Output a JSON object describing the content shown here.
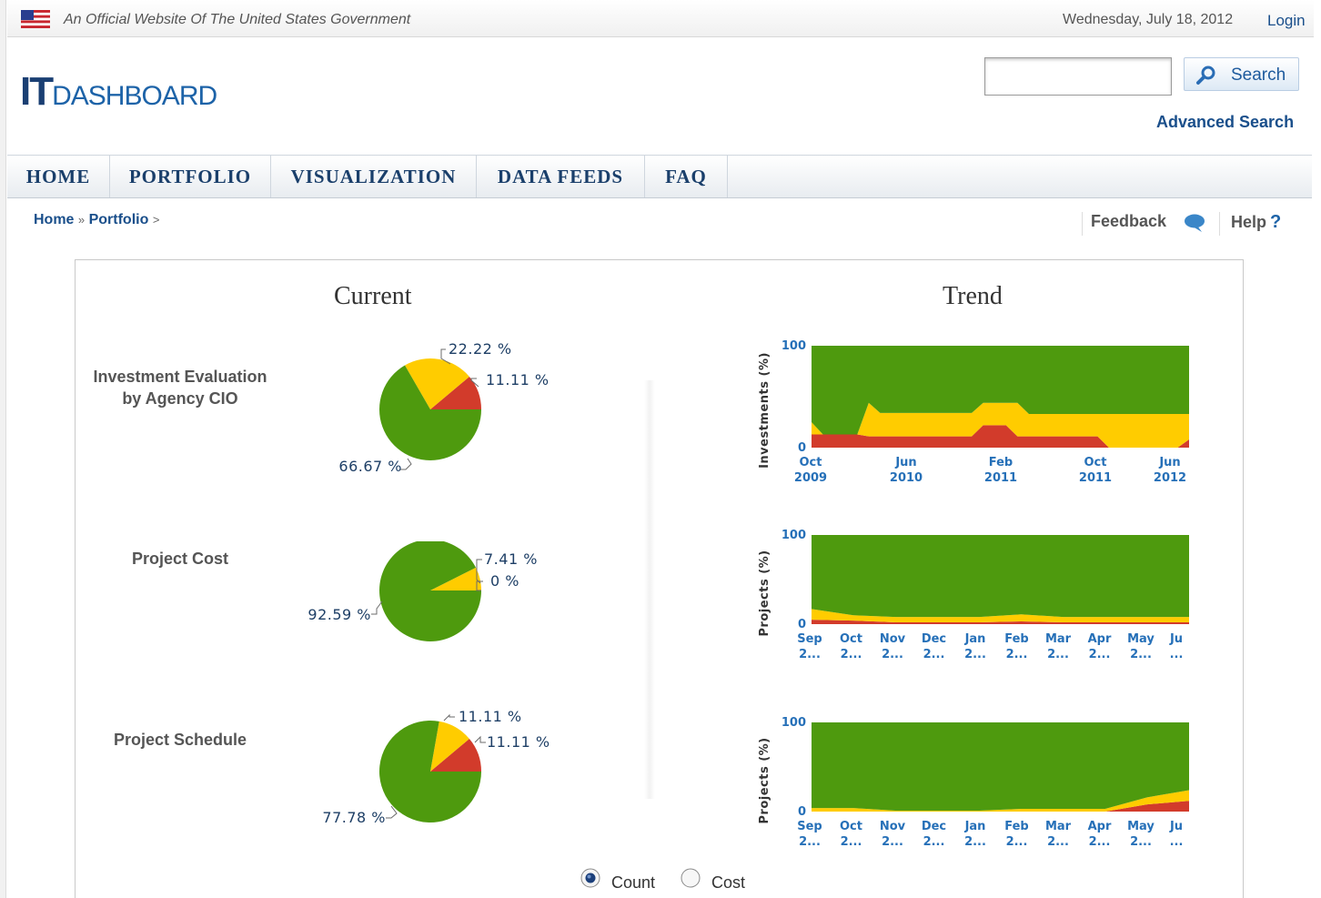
{
  "top_bar": {
    "official_text": "An Official Website Of The United States Government",
    "date": "Wednesday, July 18, 2012",
    "login": "Login"
  },
  "header": {
    "logo_it": "IT",
    "logo_dashboard": "DASHBOARD",
    "search_placeholder": "",
    "search_button": "Search",
    "advanced_search": "Advanced Search"
  },
  "nav": {
    "items": [
      {
        "label": "HOME"
      },
      {
        "label": "PORTFOLIO"
      },
      {
        "label": "VISUALIZATION"
      },
      {
        "label": "DATA FEEDS"
      },
      {
        "label": "FAQ"
      }
    ]
  },
  "breadcrumb": {
    "home": "Home",
    "sep1": "»",
    "portfolio": "Portfolio",
    "sep2": ">"
  },
  "utility": {
    "feedback": "Feedback",
    "help": "Help",
    "help_icon": "?"
  },
  "sections": {
    "current_title": "Current",
    "trend_title": "Trend"
  },
  "rows": [
    {
      "label_line1": "Investment Evaluation",
      "label_line2": "by Agency CIO"
    },
    {
      "label_line1": "Project Cost",
      "label_line2": ""
    },
    {
      "label_line1": "Project Schedule",
      "label_line2": ""
    }
  ],
  "toggle": {
    "count_label": "Count",
    "cost_label": "Cost",
    "selected": "Count"
  },
  "colors": {
    "green": "#4e9a0e",
    "yellow": "#ffcc00",
    "red": "#d23b2b",
    "nav_text": "#1a3f6b",
    "link": "#1a4f8b"
  },
  "chart_data": [
    {
      "type": "pie",
      "slices": [
        {
          "label": "22.22 %",
          "value": 22.22,
          "color": "#ffcc00"
        },
        {
          "label": "11.11 %",
          "value": 11.11,
          "color": "#d23b2b"
        },
        {
          "label": "66.67 %",
          "value": 66.67,
          "color": "#4e9a0e"
        }
      ]
    },
    {
      "type": "pie",
      "slices": [
        {
          "label": "7.41 %",
          "value": 7.41,
          "color": "#ffcc00"
        },
        {
          "label": "0 %",
          "value": 0,
          "color": "#d23b2b"
        },
        {
          "label": "92.59 %",
          "value": 92.59,
          "color": "#4e9a0e"
        }
      ]
    },
    {
      "type": "pie",
      "slices": [
        {
          "label": "11.11 %",
          "value": 11.11,
          "color": "#ffcc00"
        },
        {
          "label": "11.11 %",
          "value": 11.11,
          "color": "#d23b2b"
        },
        {
          "label": "77.78 %",
          "value": 77.78,
          "color": "#4e9a0e"
        }
      ]
    },
    {
      "type": "area",
      "ylabel": "Investments (%)",
      "ylim": [
        0,
        100
      ],
      "yticks": [
        "100",
        "0"
      ],
      "xticks": [
        {
          "line1": "Oct",
          "line2": "2009"
        },
        {
          "line1": "Jun",
          "line2": "2010"
        },
        {
          "line1": "Feb",
          "line2": "2011"
        },
        {
          "line1": "Oct",
          "line2": "2011"
        },
        {
          "line1": "Jun",
          "line2": "2012"
        }
      ],
      "x": [
        0,
        1,
        2,
        3,
        4,
        5,
        6,
        7,
        8,
        9,
        10,
        11,
        12,
        13,
        14,
        15,
        16,
        17,
        18,
        19,
        20,
        21,
        22,
        23,
        24,
        25,
        26,
        27,
        28,
        29,
        30,
        31,
        32,
        33
      ],
      "series": [
        {
          "name": "red",
          "color": "#d23b2b",
          "values": [
            13,
            13,
            13,
            13,
            13,
            11,
            11,
            11,
            11,
            11,
            11,
            11,
            11,
            11,
            11,
            22,
            22,
            22,
            11,
            11,
            11,
            11,
            11,
            11,
            11,
            11,
            0,
            0,
            0,
            0,
            0,
            0,
            0,
            8
          ]
        },
        {
          "name": "yellow",
          "color": "#ffcc00",
          "values": [
            12,
            0,
            0,
            0,
            0,
            33,
            23,
            23,
            23,
            23,
            23,
            23,
            23,
            23,
            23,
            22,
            22,
            22,
            33,
            22,
            22,
            22,
            22,
            22,
            22,
            22,
            33,
            33,
            33,
            33,
            33,
            33,
            33,
            25
          ]
        },
        {
          "name": "green",
          "color": "#4e9a0e",
          "values": [
            75,
            87,
            87,
            87,
            87,
            56,
            66,
            66,
            66,
            66,
            66,
            66,
            66,
            66,
            66,
            56,
            56,
            56,
            56,
            67,
            67,
            67,
            67,
            67,
            67,
            67,
            67,
            67,
            67,
            67,
            67,
            67,
            67,
            67
          ]
        }
      ]
    },
    {
      "type": "area",
      "ylabel": "Projects (%)",
      "ylim": [
        0,
        100
      ],
      "yticks": [
        "100",
        "0"
      ],
      "xticks": [
        {
          "line1": "Sep",
          "line2": "2..."
        },
        {
          "line1": "Oct",
          "line2": "2..."
        },
        {
          "line1": "Nov",
          "line2": "2..."
        },
        {
          "line1": "Dec",
          "line2": "2..."
        },
        {
          "line1": "Jan",
          "line2": "2..."
        },
        {
          "line1": "Feb",
          "line2": "2..."
        },
        {
          "line1": "Mar",
          "line2": "2..."
        },
        {
          "line1": "Apr",
          "line2": "2..."
        },
        {
          "line1": "May",
          "line2": "2..."
        },
        {
          "line1": "Ju",
          "line2": "..."
        }
      ],
      "x": [
        0,
        1,
        2,
        3,
        4,
        5,
        6,
        7,
        8,
        9
      ],
      "series": [
        {
          "name": "red",
          "color": "#d23b2b",
          "values": [
            5,
            4,
            2,
            2,
            2,
            3,
            2,
            2,
            2,
            2
          ]
        },
        {
          "name": "yellow",
          "color": "#ffcc00",
          "values": [
            12,
            6,
            6,
            6,
            6,
            8,
            6,
            6,
            6,
            6
          ]
        },
        {
          "name": "green",
          "color": "#4e9a0e",
          "values": [
            83,
            90,
            92,
            92,
            92,
            89,
            92,
            92,
            92,
            92
          ]
        }
      ]
    },
    {
      "type": "area",
      "ylabel": "Projects (%)",
      "ylim": [
        0,
        100
      ],
      "yticks": [
        "100",
        "0"
      ],
      "xticks": [
        {
          "line1": "Sep",
          "line2": "2..."
        },
        {
          "line1": "Oct",
          "line2": "2..."
        },
        {
          "line1": "Nov",
          "line2": "2..."
        },
        {
          "line1": "Dec",
          "line2": "2..."
        },
        {
          "line1": "Jan",
          "line2": "2..."
        },
        {
          "line1": "Feb",
          "line2": "2..."
        },
        {
          "line1": "Mar",
          "line2": "2..."
        },
        {
          "line1": "Apr",
          "line2": "2..."
        },
        {
          "line1": "May",
          "line2": "2..."
        },
        {
          "line1": "Ju",
          "line2": "..."
        }
      ],
      "x": [
        0,
        1,
        2,
        3,
        4,
        5,
        6,
        7,
        8,
        9
      ],
      "series": [
        {
          "name": "red",
          "color": "#d23b2b",
          "values": [
            0,
            0,
            0,
            0,
            0,
            0,
            0,
            0,
            8,
            12
          ]
        },
        {
          "name": "yellow",
          "color": "#ffcc00",
          "values": [
            4,
            4,
            1,
            1,
            1,
            3,
            3,
            3,
            8,
            12
          ]
        },
        {
          "name": "green",
          "color": "#4e9a0e",
          "values": [
            96,
            96,
            99,
            99,
            99,
            97,
            97,
            97,
            84,
            76
          ]
        }
      ]
    }
  ]
}
